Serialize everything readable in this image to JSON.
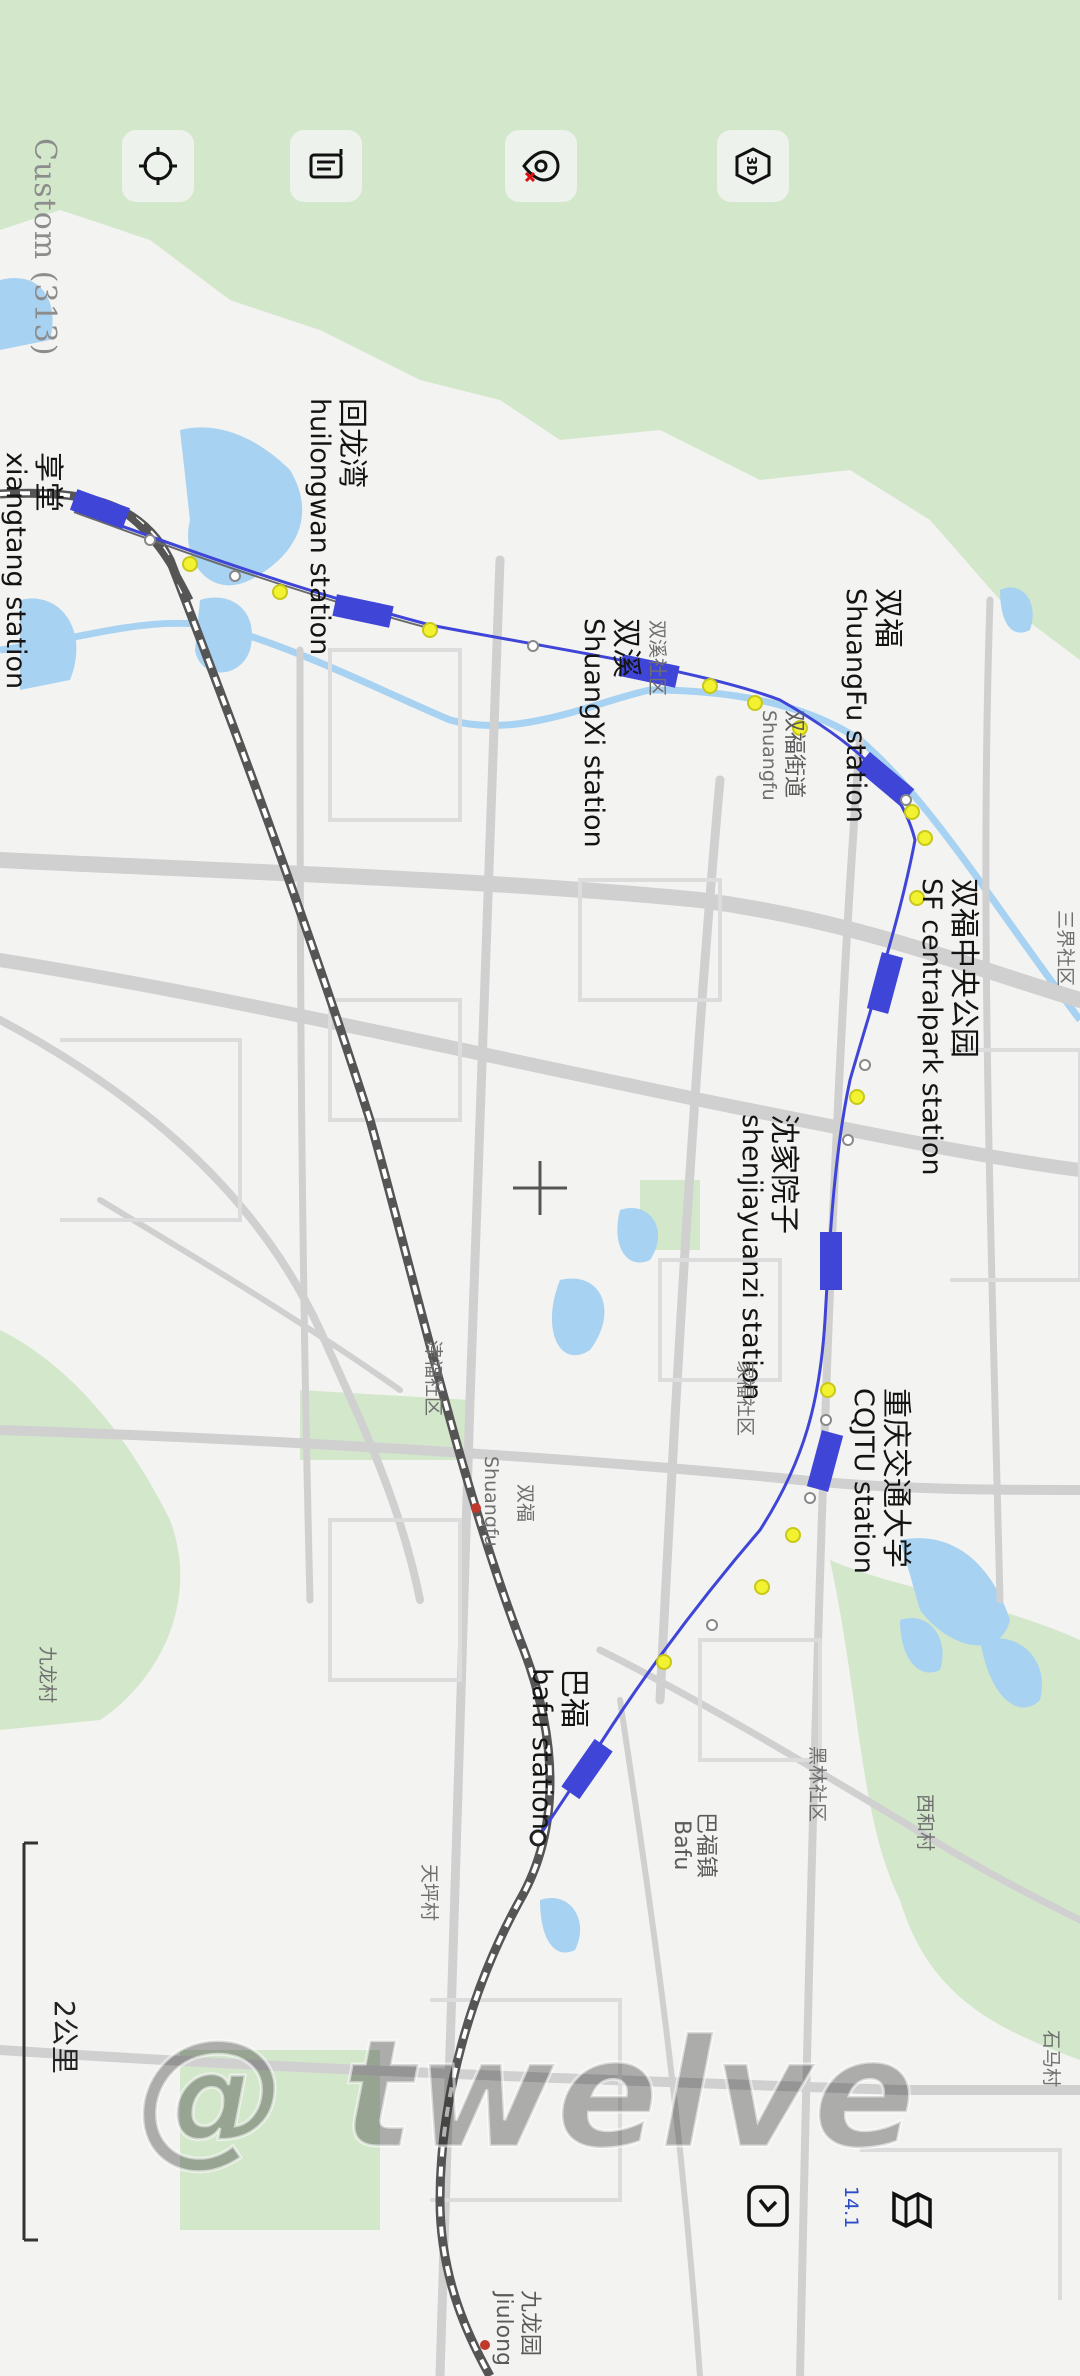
{
  "map": {
    "custom_label": "Custom (313)",
    "scale_label": "2公里",
    "zoom_level": "14.1",
    "watermark": "@ twelve",
    "colors": {
      "line": "#3f45d6",
      "station_dot": "#f2f230",
      "railway": "#555555",
      "green": "#d4e8cc",
      "water": "#a9d3f1"
    }
  },
  "controls": [
    {
      "icon": "crosshair-icon"
    },
    {
      "icon": "route-list-icon"
    },
    {
      "icon": "location-off-icon"
    },
    {
      "icon": "3d-cube-icon"
    }
  ],
  "bottom_controls": [
    {
      "icon": "compass-icon"
    },
    {
      "icon": "map-layers-icon"
    }
  ],
  "stations": [
    {
      "id": "xiangtang",
      "cn": "享堂",
      "en": "xiangtang station"
    },
    {
      "id": "huilongwan",
      "cn": "回龙湾",
      "en": "huilongwan station"
    },
    {
      "id": "shuangxi",
      "cn": "双溪",
      "en": "ShuangXi station"
    },
    {
      "id": "shuangfu",
      "cn": "双福",
      "en": "ShuangFu station"
    },
    {
      "id": "sf-centralpark",
      "cn": "双福中央公园",
      "en": "SF centralpark station"
    },
    {
      "id": "shenjiayuanzi",
      "cn": "沈家院子",
      "en": "shenjiayuanzi station"
    },
    {
      "id": "cqjtu",
      "cn": "重庆交通大学",
      "en": "CQJTU station"
    },
    {
      "id": "bafu",
      "cn": "巴福",
      "en": "bafu station"
    }
  ],
  "places": {
    "shuangxi_community": "双溪社区",
    "shuangfu_street": "双福街道",
    "shuangfu_en": "Shuangfu",
    "sanjie_community": "三界社区",
    "jinfu_community": "津福社区",
    "shuangfu_rail": "Shuangfu",
    "shuangfu_cn": "双福",
    "jiulong_village": "九龙村",
    "tianping_village": "天坪村",
    "bafu_town": "巴福镇",
    "bafu_en": "Bafu",
    "heilin_community": "黑林社区",
    "xihe_village": "西和村",
    "shima_village": "石马村",
    "jiulongyuan": "九龙园",
    "jiulong_en": "Jiulong",
    "jiafu_community": "家福社区"
  }
}
